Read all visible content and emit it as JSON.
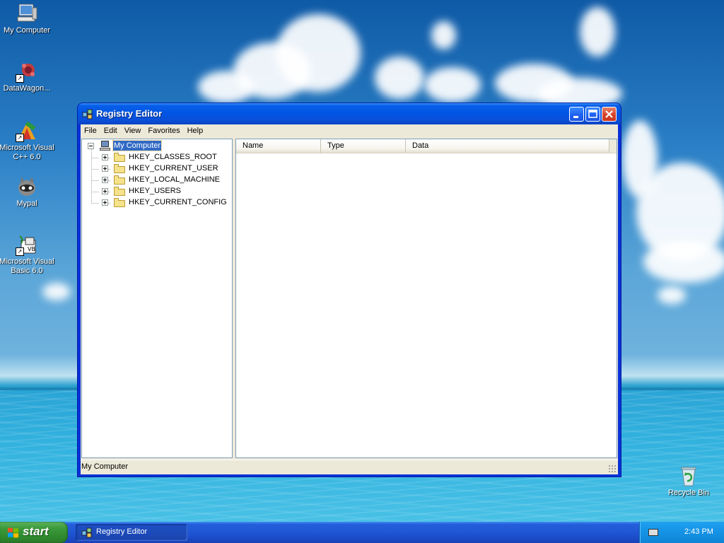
{
  "desktop": {
    "icons": [
      {
        "label": "My Computer",
        "icon": "my-computer-icon"
      },
      {
        "label": "DataWagon...",
        "icon": "datawagon-icon"
      },
      {
        "label": "Microsoft Visual\nC++ 6.0",
        "icon": "visual-cpp-icon"
      },
      {
        "label": "Mypal",
        "icon": "mypal-icon"
      },
      {
        "label": "Microsoft Visual\nBasic 6.0",
        "icon": "visual-basic-icon"
      },
      {
        "label": "Recycle Bin",
        "icon": "recycle-bin-icon"
      }
    ]
  },
  "window": {
    "title": "Registry Editor",
    "menu": [
      "File",
      "Edit",
      "View",
      "Favorites",
      "Help"
    ],
    "tree": {
      "root": "My Computer",
      "keys": [
        "HKEY_CLASSES_ROOT",
        "HKEY_CURRENT_USER",
        "HKEY_LOCAL_MACHINE",
        "HKEY_USERS",
        "HKEY_CURRENT_CONFIG"
      ]
    },
    "list": {
      "columns": [
        "Name",
        "Type",
        "Data"
      ]
    },
    "status": "My Computer"
  },
  "taskbar": {
    "start_label": "start",
    "tasks": [
      {
        "label": "Registry Editor"
      }
    ],
    "clock": "2:43 PM"
  },
  "colors": {
    "titlebar": "#0055e5",
    "selection": "#316ac5",
    "start_green": "#3c9b3b",
    "tray_blue": "#1695e8"
  }
}
